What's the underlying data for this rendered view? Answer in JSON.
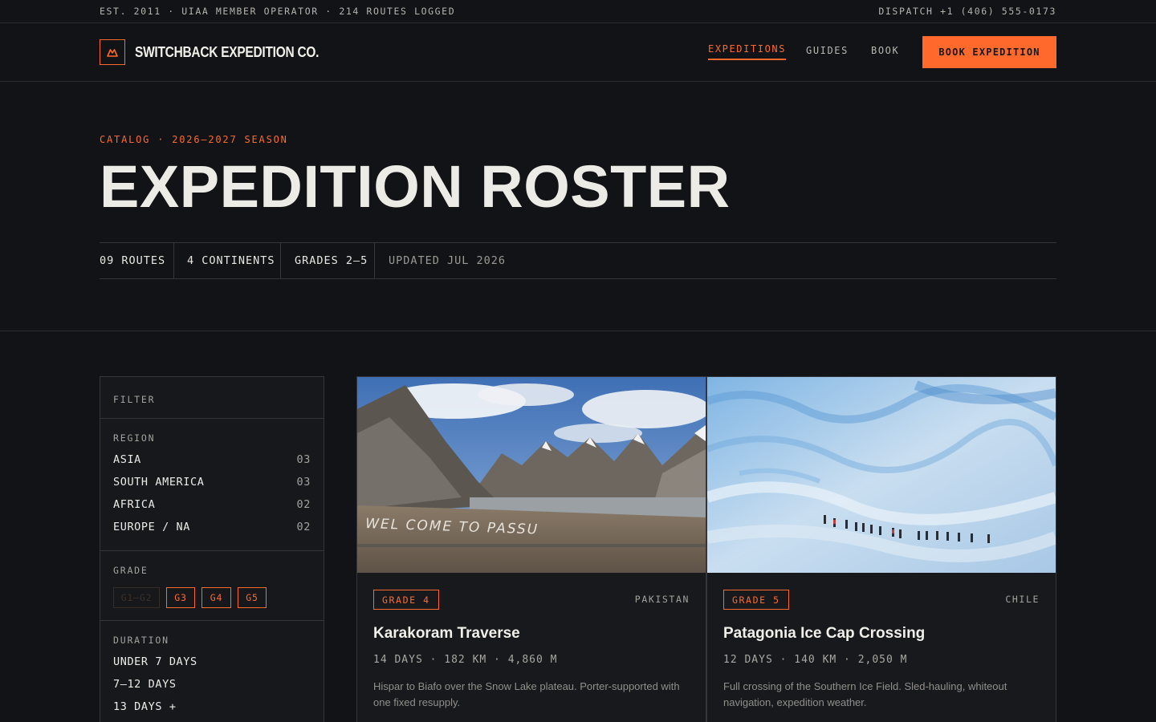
{
  "topbar": {
    "left": "EST. 2011 · UIAA MEMBER OPERATOR · 214 ROUTES LOGGED",
    "right": "DISPATCH +1 (406) 555-0173"
  },
  "header": {
    "brand": "SWITCHBACK EXPEDITION CO.",
    "nav": [
      "EXPEDITIONS",
      "GUIDES",
      "BOOK"
    ],
    "active_nav": "EXPEDITIONS",
    "cta": "BOOK EXPEDITION"
  },
  "hero": {
    "eyebrow": "CATALOG · 2026–2027 SEASON",
    "title": "EXPEDITION ROSTER",
    "stats": [
      "09 ROUTES",
      "4 CONTINENTS",
      "GRADES 2–5",
      "UPDATED JUL 2026"
    ]
  },
  "filter": {
    "title": "FILTER",
    "region": {
      "heading": "REGION",
      "items": [
        {
          "label": "ASIA",
          "count": "03"
        },
        {
          "label": "SOUTH AMERICA",
          "count": "03"
        },
        {
          "label": "AFRICA",
          "count": "02"
        },
        {
          "label": "EUROPE / NA",
          "count": "02"
        }
      ]
    },
    "grade": {
      "heading": "GRADE",
      "chips": [
        "G1–G2",
        "G3",
        "G4",
        "G5"
      ]
    },
    "duration": {
      "heading": "DURATION",
      "items": [
        "UNDER 7 DAYS",
        "7–12 DAYS",
        "13 DAYS +"
      ]
    }
  },
  "cards": [
    {
      "grade": "GRADE 4",
      "country": "PAKISTAN",
      "title": "Karakoram Traverse",
      "meta": "14 DAYS · 182 KM · 4,860 M",
      "desc": "Hispar to Biafo over the Snow Lake plateau. Porter-supported with one fixed resupply.",
      "image_text": "WEL COME TO PASSU"
    },
    {
      "grade": "GRADE 5",
      "country": "CHILE",
      "title": "Patagonia Ice Cap Crossing",
      "meta": "12 DAYS · 140 KM · 2,050 M",
      "desc": "Full crossing of the Southern Ice Field. Sled-hauling, whiteout navigation, expedition weather."
    }
  ],
  "colors": {
    "accent": "#ff6a2c",
    "background": "#121316",
    "text": "#ecebe6",
    "muted": "#a3a29c"
  }
}
